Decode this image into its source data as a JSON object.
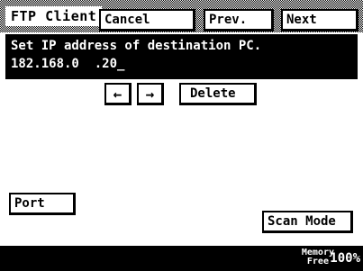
{
  "header": {
    "title": "FTP Client",
    "cancel_label": "Cancel",
    "prev_label": "Prev.",
    "next_label": "Next"
  },
  "message": {
    "line1": "Set IP address of destination PC.",
    "line2": "182.168.0  .20_"
  },
  "controls": {
    "left_arrow": "←",
    "right_arrow": "→",
    "delete_label": "Delete"
  },
  "buttons": {
    "port_label": "Port",
    "scan_mode_label": "Scan Mode"
  },
  "status": {
    "memory_line1": "Memory",
    "memory_line2": "Free",
    "memory_value": "100%"
  }
}
